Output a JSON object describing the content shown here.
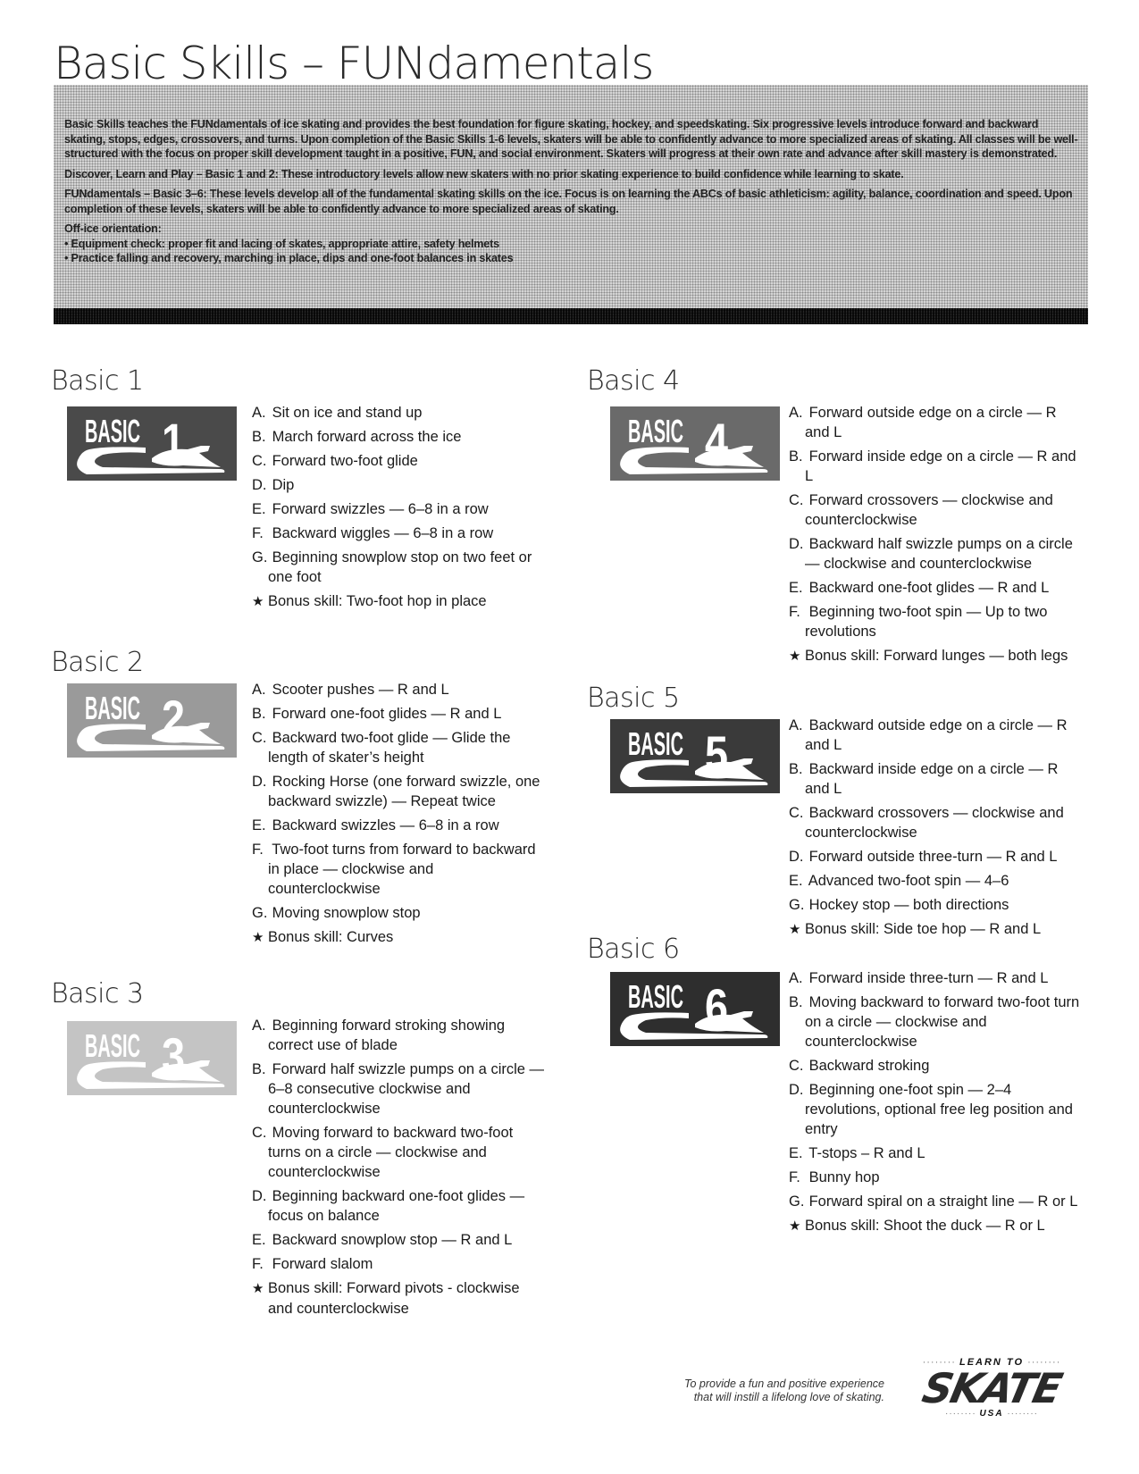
{
  "header": {
    "title": "Basic Skills – FUNdamentals"
  },
  "intro": {
    "paragraph_1": "Basic Skills teaches the FUNdamentals of ice skating and provides the best foundation for figure skating, hockey, and speedskating. Six progressive levels introduce forward and backward skating, stops, edges, crossovers, and turns. Upon completion of the Basic Skills 1-6 levels, skaters will be able to confidently advance to more specialized areas of skating. All classes will be well-structured with the focus on proper skill development taught in a positive, FUN, and social environment. Skaters will progress at their own rate and advance after skill mastery is demonstrated.",
    "paragraph_2": "Discover, Learn and Play – Basic 1 and 2: These introductory levels allow new skaters with no prior skating experience to build confidence while learning to skate.",
    "paragraph_3": "FUNdamentals – Basic 3–6: These levels develop all of the fundamental skating skills on the ice. Focus is on learning the ABCs of basic athleticism: agility, balance, coordination and speed. Upon completion of these levels, skaters will be able to confidently advance to more specialized areas of skating.",
    "off_ice_title": "Off-ice orientation:",
    "off_ice_items": [
      "• Equipment check: proper fit and lacing of skates, appropriate attire, safety helmets",
      "• Practice falling and recovery, marching in place, dips and one-foot balances in skates"
    ]
  },
  "levels": [
    {
      "heading": "Basic 1",
      "logo_word": "BASIC",
      "logo_number": "1",
      "logo_shade": "#4a4a4a",
      "skills": [
        {
          "letter": "A.",
          "text": "Sit on ice and stand up"
        },
        {
          "letter": "B.",
          "text": "March forward across the ice"
        },
        {
          "letter": "C.",
          "text": "Forward two-foot glide"
        },
        {
          "letter": "D.",
          "text": "Dip"
        },
        {
          "letter": "E.",
          "text": "Forward swizzles — 6–8 in a row"
        },
        {
          "letter": "F.",
          "text": "Backward wiggles — 6–8 in a row"
        },
        {
          "letter": "G.",
          "text": "Beginning snowplow stop on two feet or one foot"
        }
      ],
      "bonus": "Bonus skill: Two-foot hop in place"
    },
    {
      "heading": "Basic 2",
      "logo_word": "BASIC",
      "logo_number": "2",
      "logo_shade": "#9a9a9a",
      "skills": [
        {
          "letter": "A.",
          "text": "Scooter pushes — R and L"
        },
        {
          "letter": "B.",
          "text": "Forward one-foot glides — R and L"
        },
        {
          "letter": "C.",
          "text": "Backward two-foot glide — Glide the length of skater’s height"
        },
        {
          "letter": "D.",
          "text": "Rocking Horse (one forward swizzle, one backward swizzle) — Repeat twice"
        },
        {
          "letter": "E.",
          "text": "Backward swizzles — 6–8 in a row"
        },
        {
          "letter": "F.",
          "text": "Two-foot turns from forward to backward in place — clockwise and counterclockwise"
        },
        {
          "letter": "G.",
          "text": "Moving snowplow stop"
        }
      ],
      "bonus": "Bonus skill: Curves"
    },
    {
      "heading": "Basic 3",
      "logo_word": "BASIC",
      "logo_number": "3",
      "logo_shade": "#c4c4c4",
      "skills": [
        {
          "letter": "A.",
          "text": "Beginning forward stroking showing correct use of blade"
        },
        {
          "letter": "B.",
          "text": "Forward half swizzle pumps on a circle — 6–8 consecutive clockwise and counterclockwise"
        },
        {
          "letter": "C.",
          "text": "Moving forward to backward two-foot turns on a circle — clockwise and counterclockwise"
        },
        {
          "letter": "D.",
          "text": "Beginning backward one-foot glides — focus on balance"
        },
        {
          "letter": "E.",
          "text": "Backward snowplow stop — R and L"
        },
        {
          "letter": "F.",
          "text": "Forward slalom"
        }
      ],
      "bonus": "Bonus skill: Forward pivots - clockwise and counterclockwise"
    },
    {
      "heading": "Basic 4",
      "logo_word": "BASIC",
      "logo_number": "4",
      "logo_shade": "#6a6a6a",
      "skills": [
        {
          "letter": "A.",
          "text": "Forward outside edge on a circle — R and L"
        },
        {
          "letter": "B.",
          "text": "Forward inside edge on a circle — R and L"
        },
        {
          "letter": "C.",
          "text": "Forward crossovers — clockwise and counterclockwise"
        },
        {
          "letter": "D.",
          "text": "Backward half swizzle pumps on a circle — clockwise and counterclockwise"
        },
        {
          "letter": "E.",
          "text": "Backward one-foot glides — R and L"
        },
        {
          "letter": "F.",
          "text": "Beginning two-foot spin — Up to two revolutions"
        }
      ],
      "bonus": "Bonus skill: Forward lunges — both legs"
    },
    {
      "heading": "Basic 5",
      "logo_word": "BASIC",
      "logo_number": "5",
      "logo_shade": "#3a3a3a",
      "skills": [
        {
          "letter": "A.",
          "text": "Backward outside edge on a circle — R and L"
        },
        {
          "letter": "B.",
          "text": "Backward inside edge on a circle — R and L"
        },
        {
          "letter": "C.",
          "text": "Backward crossovers — clockwise and counterclockwise"
        },
        {
          "letter": "D.",
          "text": "Forward outside three-turn — R and L"
        },
        {
          "letter": "E.",
          "text": "Advanced two-foot spin — 4–6"
        },
        {
          "letter": "G.",
          "text": "Hockey stop — both directions"
        }
      ],
      "bonus": "Bonus skill: Side toe hop — R and L"
    },
    {
      "heading": "Basic 6",
      "logo_word": "BASIC",
      "logo_number": "6",
      "logo_shade": "#2e2e2e",
      "skills": [
        {
          "letter": "A.",
          "text": "Forward inside three-turn — R and L"
        },
        {
          "letter": "B.",
          "text": "Moving backward to forward two-foot turn on a circle — clockwise and counterclockwise"
        },
        {
          "letter": "C.",
          "text": "Backward stroking"
        },
        {
          "letter": "D.",
          "text": "Beginning one-foot spin — 2–4 revolutions, optional free leg position and entry"
        },
        {
          "letter": "E.",
          "text": "T-stops – R and L"
        },
        {
          "letter": "F.",
          "text": "Bunny hop"
        },
        {
          "letter": "G.",
          "text": "Forward spiral on a straight line — R or L"
        }
      ],
      "bonus": "Bonus skill: Shoot the duck — R or L"
    }
  ],
  "footer": {
    "motto_line_1": "To provide a fun and positive experience",
    "motto_line_2": "that will instill a lifelong love of skating.",
    "brand_top": "LEARN TO",
    "brand_main": "SKATE",
    "brand_bottom": "USA",
    "star_glyph": "★"
  }
}
